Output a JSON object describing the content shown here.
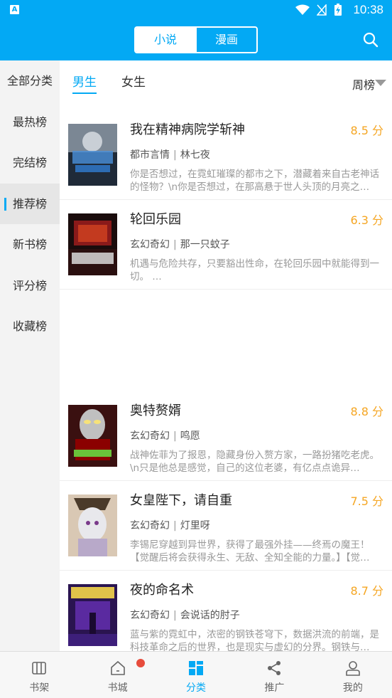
{
  "status": {
    "time": "10:38",
    "app_icon": "A"
  },
  "header": {
    "tabs": [
      "小说",
      "漫画"
    ],
    "active_tab": "小说",
    "search_icon": "search-icon"
  },
  "sidebar": {
    "items": [
      "全部分类",
      "最热榜",
      "完结榜",
      "推荐榜",
      "新书榜",
      "评分榜",
      "收藏榜"
    ],
    "active": "推荐榜"
  },
  "gender_tabs": {
    "male": "男生",
    "female": "女生",
    "active": "男生"
  },
  "period": {
    "label": "周榜"
  },
  "books": [
    {
      "title": "我在精神病院学斩神",
      "score": "8.5 分",
      "category": "都市言情",
      "author": "林七夜",
      "desc": "你是否想过，在霓虹璀璨的都市之下，潜藏着来自古老神话的怪物？\\n你是否想过，在那高悬于世人头顶的月亮之…"
    },
    {
      "title": "轮回乐园",
      "score": "6.3 分",
      "category": "玄幻奇幻",
      "author": "那一只蚊子",
      "desc": "机遇与危险共存，只要豁出性命，在轮回乐园中就能得到一切。 …"
    },
    {
      "title": "奥特赘婿",
      "score": "8.8 分",
      "category": "玄幻奇幻",
      "author": "鸣愿",
      "desc": "战神佐菲为了报恩，隐藏身份入赘方家，一路扮猪吃老虎。\\n只是他总是感觉，自己的这位老婆，有亿点点诡异…"
    },
    {
      "title": "女皇陛下，请自重",
      "score": "7.5 分",
      "category": "玄幻奇幻",
      "author": "灯里呀",
      "desc": "李锡尼穿越到异世界，获得了最强外挂——终焉の魔王！【觉醒后将会获得永生、无敌、全知全能的力量。】【觉…"
    },
    {
      "title": "夜的命名术",
      "score": "8.7 分",
      "category": "玄幻奇幻",
      "author": "会说话的肘子",
      "desc": "蓝与紫的霓虹中，浓密的钢铁苍穹下，数据洪流的前端，是科技革命之后的世界，也是现实与虚幻的分界。钢铁与…"
    }
  ],
  "bottom_nav": [
    {
      "label": "书架",
      "icon": "bookshelf-icon"
    },
    {
      "label": "书城",
      "icon": "home-icon"
    },
    {
      "label": "分类",
      "icon": "category-grid-icon"
    },
    {
      "label": "推广",
      "icon": "share-icon"
    },
    {
      "label": "我的",
      "icon": "user-icon"
    }
  ],
  "bottom_active": "分类",
  "colors": {
    "accent": "#03a9f4",
    "score": "#f5a623",
    "badge": "#e74c3c"
  }
}
